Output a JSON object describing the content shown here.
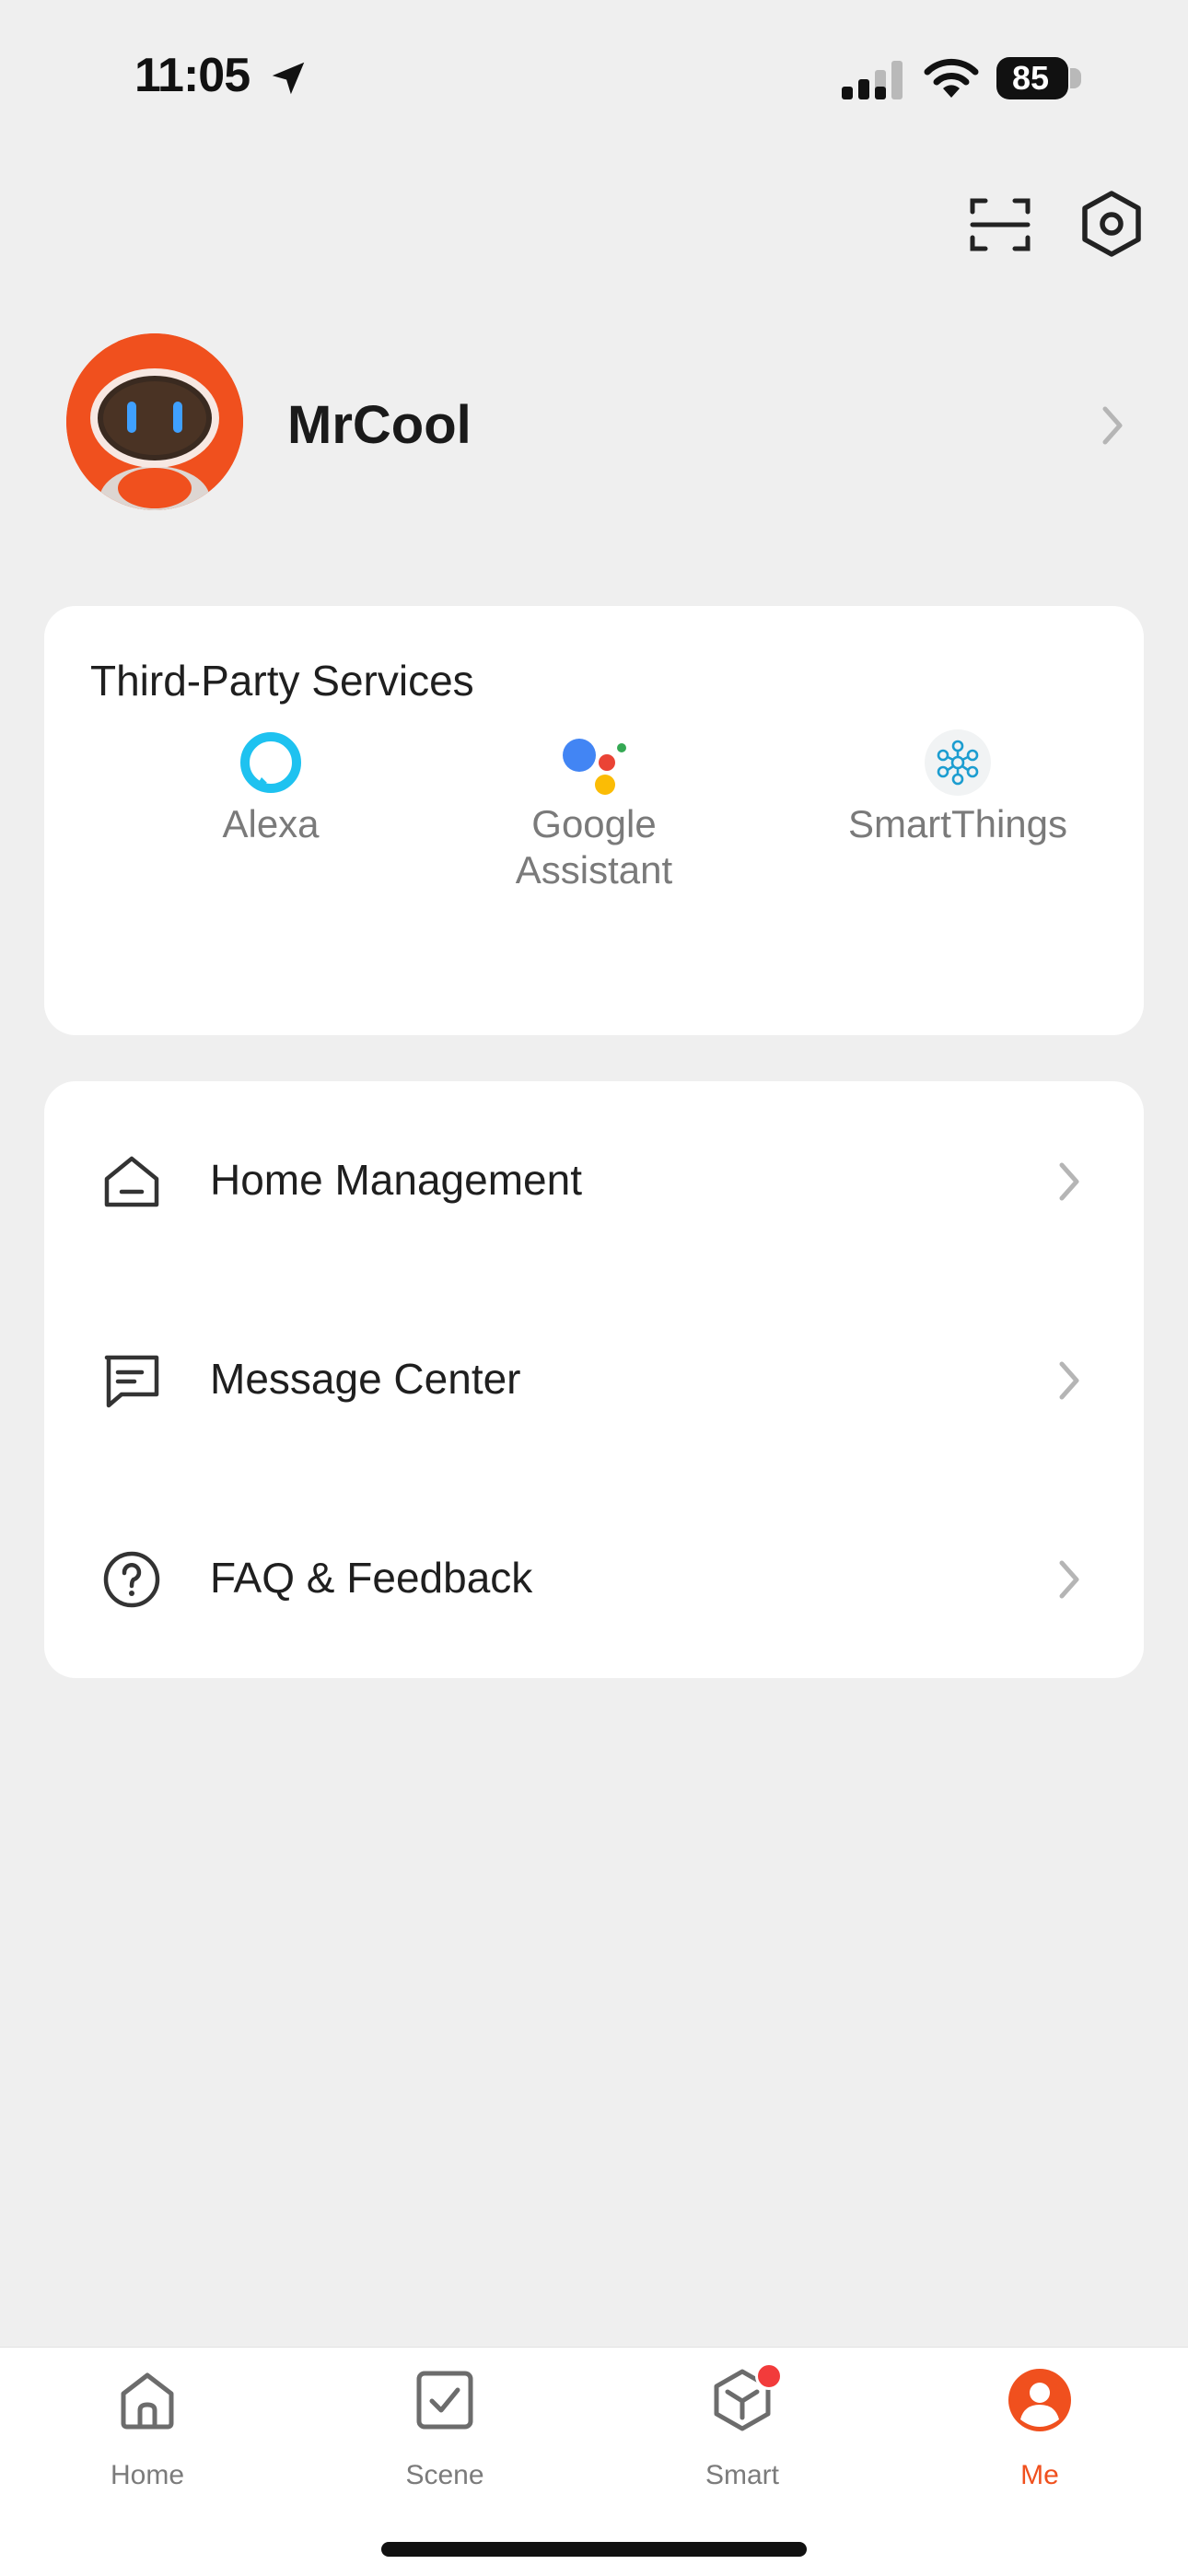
{
  "status_bar": {
    "time": "11:05",
    "battery": "85"
  },
  "profile": {
    "name": "MrCool"
  },
  "third_party": {
    "title": "Third-Party Services",
    "services": [
      {
        "label": "Alexa",
        "icon": "alexa-icon"
      },
      {
        "label": "Google Assistant",
        "icon": "google-assistant-icon"
      },
      {
        "label": "SmartThings",
        "icon": "smartthings-icon"
      }
    ]
  },
  "menu": [
    {
      "label": "Home Management",
      "icon": "house-icon"
    },
    {
      "label": "Message Center",
      "icon": "message-icon"
    },
    {
      "label": "FAQ & Feedback",
      "icon": "question-icon"
    }
  ],
  "tabs": [
    {
      "label": "Home",
      "icon": "home-icon"
    },
    {
      "label": "Scene",
      "icon": "scene-check-icon"
    },
    {
      "label": "Smart",
      "icon": "smart-cube-icon",
      "badge": true
    },
    {
      "label": "Me",
      "icon": "person-icon",
      "active": true
    }
  ],
  "colors": {
    "accent": "#f0501e",
    "background": "#efefef",
    "card": "#ffffff",
    "badge": "#f23b3b"
  }
}
